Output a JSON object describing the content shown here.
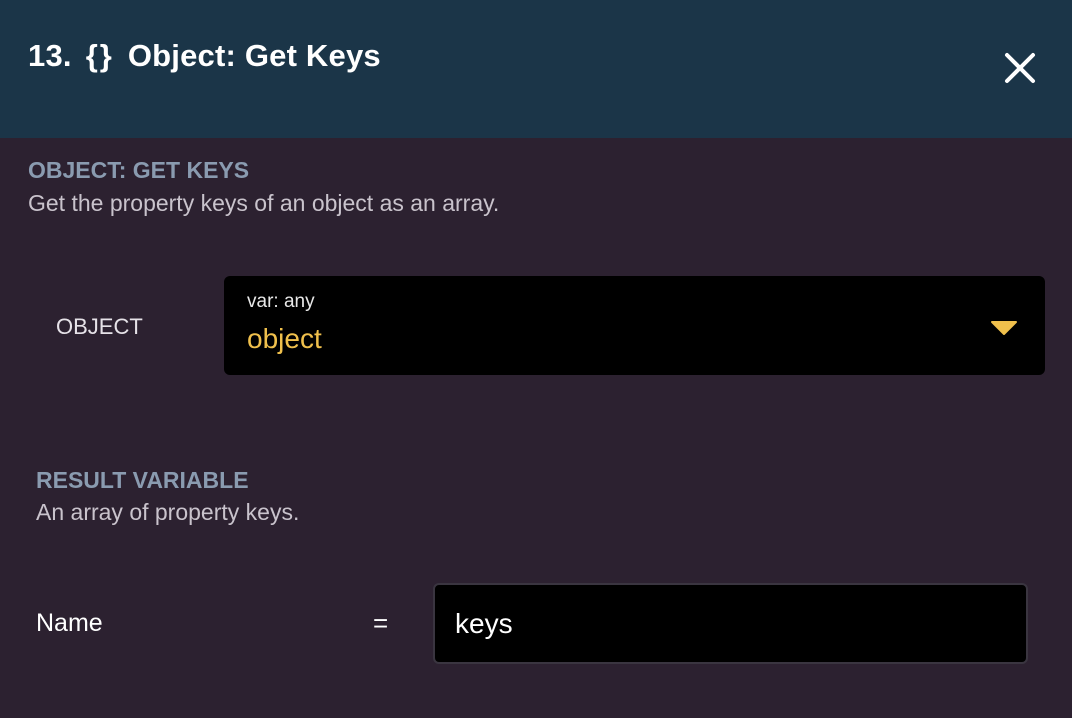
{
  "header": {
    "step_number": "13.",
    "icon_glyph": "{}",
    "title": "Object: Get Keys",
    "close_icon": "close-icon"
  },
  "colors": {
    "header_bg": "#1b3548",
    "panel_bg": "#2c2130",
    "section_title": "#8a9bb0",
    "variable_value": "#f0c04c"
  },
  "action": {
    "title": "OBJECT: GET KEYS",
    "description": "Get the property keys of an object as an array."
  },
  "object_field": {
    "label": "OBJECT",
    "type_label": "var: any",
    "value": "object",
    "dropdown_icon": "caret-down-icon"
  },
  "result": {
    "title": "RESULT VARIABLE",
    "description": "An array of property keys.",
    "name_label": "Name",
    "equals": "=",
    "name_value": "keys"
  }
}
